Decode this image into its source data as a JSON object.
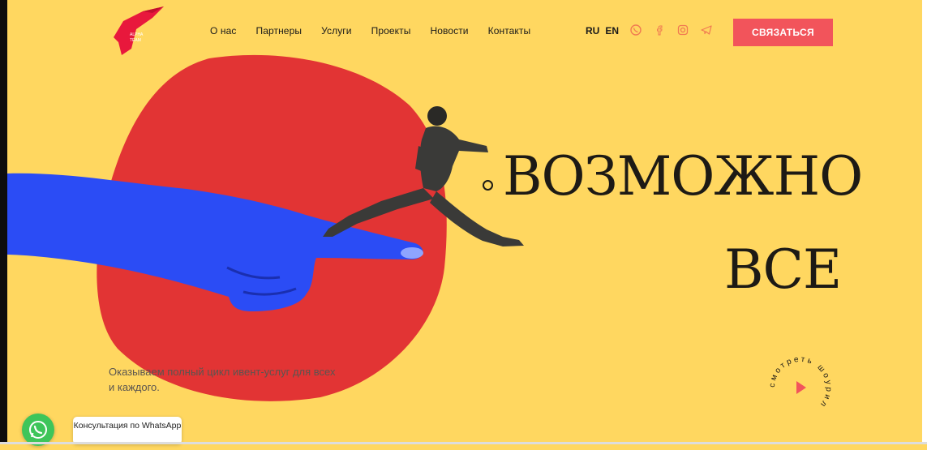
{
  "nav": {
    "items": [
      "О нас",
      "Партнеры",
      "Услуги",
      "Проекты",
      "Новости",
      "Контакты"
    ]
  },
  "lang": {
    "ru": "RU",
    "en": "EN"
  },
  "socials": [
    "whatsapp-icon",
    "facebook-icon",
    "instagram-icon",
    "telegram-icon"
  ],
  "cta": {
    "label": "связаться"
  },
  "logo": {
    "text_top": "ALPHA",
    "text_bottom": "TEAM"
  },
  "hero": {
    "line1": "ВОЗМОЖНО",
    "line2": "ВСЕ",
    "subtitle": "Оказываем полный цикл ивент-услуг для всех и каждого."
  },
  "showreel": {
    "label": "смотреть шоурил"
  },
  "whatsapp": {
    "tooltip": "Консультация по WhatsApp"
  },
  "colors": {
    "background": "#ffd760",
    "blob": "#e23434",
    "cta": "#f2545b",
    "accent_icon": "#f07a52",
    "hand": "#2b4cf5"
  }
}
